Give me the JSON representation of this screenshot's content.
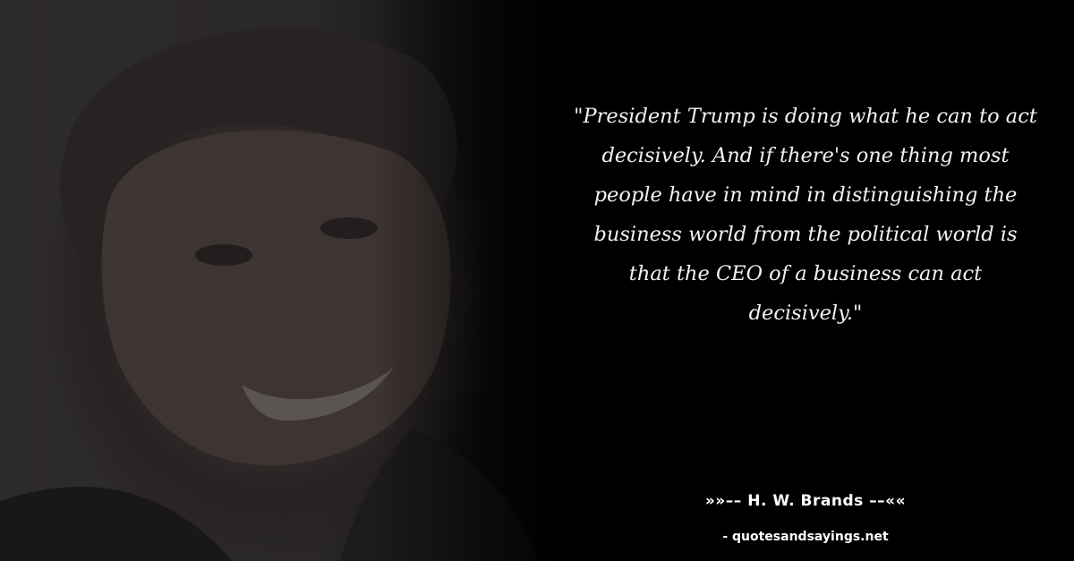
{
  "quote": {
    "text": "\"President Trump is doing what he can to act decisively. And if there's one thing most people have in mind in distinguishing the business world from the political world is that the CEO of a business can act decisively.\""
  },
  "author": {
    "line": "»»–– H. W. Brands ––««"
  },
  "source": {
    "line": "- quotesandsayings.net"
  }
}
